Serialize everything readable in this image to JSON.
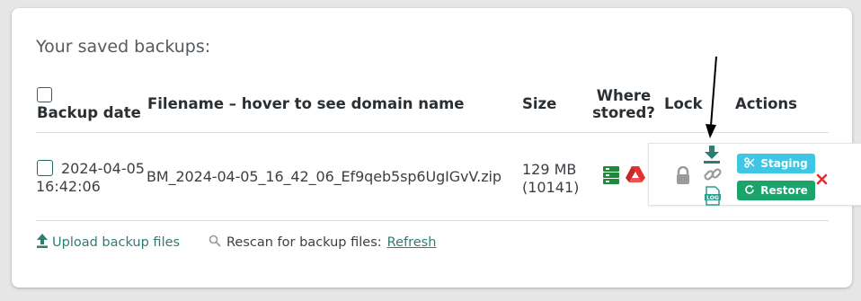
{
  "section": {
    "title": "Your saved backups:"
  },
  "table": {
    "headers": {
      "backup_date": "Backup date",
      "filename": "Filename – hover to see domain name",
      "size": "Size",
      "where_stored_line1": "Where",
      "where_stored_line2": "stored?",
      "lock": "Lock",
      "actions": "Actions"
    },
    "rows": [
      {
        "date_line1": "2024-04-05",
        "date_line2": "16:42:06",
        "filename": "BM_2024-04-05_16_42_06_Ef9qeb5sp6UgIGvV.zip",
        "size_line1": "129 MB",
        "size_line2": "(10141)",
        "storage_icons": [
          "server-storage-icon",
          "google-drive-icon"
        ],
        "lock_icon": "padlock-icon",
        "action_icons": [
          "download-icon",
          "link-icon",
          "log-file-icon"
        ],
        "staging_label": "Staging",
        "restore_label": "Restore",
        "delete_icon": "delete-x-icon"
      }
    ]
  },
  "footer": {
    "upload_label": "Upload backup files",
    "rescan_label": "Rescan for backup files:",
    "refresh_label": "Refresh"
  },
  "colors": {
    "accent": "#2e7d73",
    "staging": "#3fc6e3",
    "restore": "#1aa36a",
    "delete": "#d9343a",
    "server": "#1f8a3a",
    "drive": "#e3332f"
  }
}
